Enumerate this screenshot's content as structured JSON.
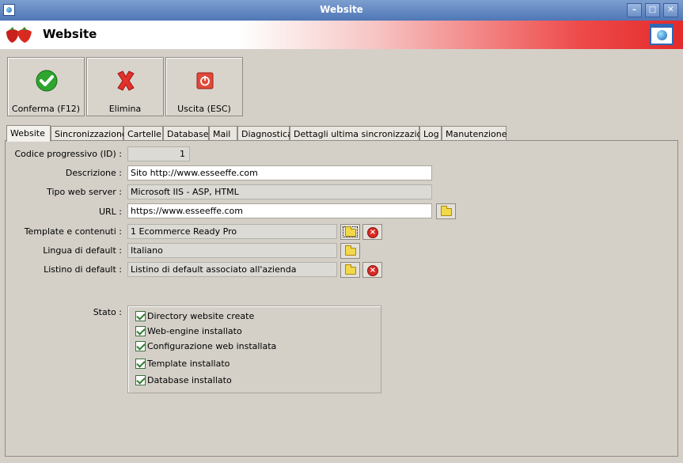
{
  "window": {
    "title": "Website"
  },
  "header": {
    "title": "Website"
  },
  "toolbar": {
    "confirm_label": "Conferma (F12)",
    "delete_label": "Elimina",
    "exit_label": "Uscita (ESC)"
  },
  "tabs": [
    "Website",
    "Sincronizzazione",
    "Cartelle",
    "Database",
    "Mail",
    "Diagnostica",
    "Dettagli ultima sincronizzazione",
    "Log",
    "Manutenzione"
  ],
  "form": {
    "id_label": "Codice progressivo (ID) :",
    "id_value": "1",
    "descrizione_label": "Descrizione :",
    "descrizione_value": "Sito http://www.esseeffe.com",
    "server_label": "Tipo web server :",
    "server_value": "Microsoft IIS - ASP, HTML",
    "url_label": "URL :",
    "url_value": "https://www.esseeffe.com",
    "template_label": "Template e contenuti :",
    "template_value": "1 Ecommerce Ready Pro",
    "lingua_label": "Lingua di default :",
    "lingua_value": "Italiano",
    "listino_label": "Listino di default :",
    "listino_value": "Listino di default associato all'azienda",
    "stato_label": "Stato :"
  },
  "stato": [
    {
      "label": "Directory website create",
      "checked": true
    },
    {
      "label": "Web-engine installato",
      "checked": true
    },
    {
      "label": "Configurazione web installata",
      "checked": true
    },
    {
      "label": "Template installato",
      "checked": true
    },
    {
      "label": "Database installato",
      "checked": true
    }
  ],
  "colors": {
    "accent": "#e42a2a",
    "titlebar": "#5a7fbc"
  }
}
